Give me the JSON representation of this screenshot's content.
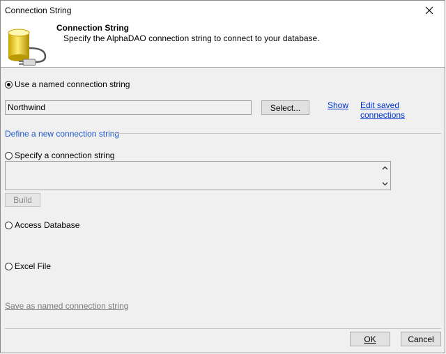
{
  "window": {
    "title": "Connection String"
  },
  "header": {
    "title": "Connection String",
    "description": "Specify the AlphaDAO connection string to connect to your database."
  },
  "named": {
    "radio_label": "Use a named connection string",
    "selected": true,
    "value": "Northwind",
    "select_label": "Select...",
    "show_label": "Show",
    "edit_label": "Edit saved connections"
  },
  "define_new": {
    "section_label": "Define a new connection string"
  },
  "specify": {
    "radio_label": "Specify a connection string",
    "selected": false,
    "value": "",
    "build_label": "Build"
  },
  "access": {
    "radio_label": "Access Database",
    "selected": false
  },
  "excel": {
    "radio_label": "Excel File",
    "selected": false
  },
  "save_link": "Save as named connection string",
  "footer": {
    "ok_label": "OK",
    "cancel_label": "Cancel"
  },
  "colors": {
    "link": "#0033cc",
    "section": "#1e56c8",
    "dialog_bg": "#f0f0f0"
  }
}
